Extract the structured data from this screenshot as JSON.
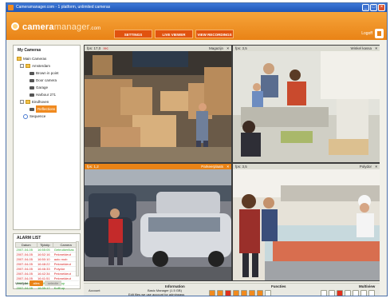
{
  "window": {
    "title": "Cameramanager.com - 1 platform, unlimited cameras"
  },
  "header": {
    "logo_main": "camera",
    "logo_second": "manager",
    "logo_suffix": ".com",
    "tabs": [
      {
        "label": "SETTINGS"
      },
      {
        "label": "LIVE VIEWER"
      },
      {
        "label": "VIEW RECORDINGS"
      }
    ],
    "logout_label": "Logoff"
  },
  "sidebar": {
    "title": "My Cameras",
    "tree": [
      {
        "label": "Main Cameras"
      },
      {
        "label": "Amsterdam"
      },
      {
        "label": "Brown in point"
      },
      {
        "label": "Door camera"
      },
      {
        "label": "Garage"
      },
      {
        "label": "Harbour 271"
      },
      {
        "label": "Eindhoven"
      },
      {
        "label": "Reflections"
      },
      {
        "label": "Sequence"
      }
    ]
  },
  "alarm": {
    "title": "ALARM LIST",
    "columns": [
      "Datum",
      "Tijdstip",
      "Camera"
    ],
    "rows": [
      {
        "date": "2007-04-05",
        "time": "16:55:05",
        "camera": "Gebruiker/kas"
      },
      {
        "date": "2007-04-05",
        "time": "16:52:16",
        "camera": "Pekmeldeut"
      },
      {
        "date": "2007-04-05",
        "time": "16:50:10",
        "camera": "auto mob"
      },
      {
        "date": "2007-04-05",
        "time": "16:48:22",
        "camera": "Pekmeldeut"
      },
      {
        "date": "2007-04-05",
        "time": "16:46:33",
        "camera": "Polydor"
      },
      {
        "date": "2007-04-05",
        "time": "16:42:34",
        "camera": "Pekmeldeut"
      },
      {
        "date": "2007-04-05",
        "time": "16:41:51",
        "camera": "Pekmeldeut"
      },
      {
        "date": "2007-04-05",
        "time": "16:39:16",
        "camera": "Koffi up"
      },
      {
        "date": "2007-04-05",
        "time": "16:35:17",
        "camera": "Koffi up"
      }
    ],
    "footer_label": "Verwijder",
    "btn_all": "alles",
    "btn_select": "selectie"
  },
  "panes": [
    {
      "fps": "fps: 17,0",
      "rec": "rec",
      "name": "Magazijn"
    },
    {
      "fps": "fps: 3,5",
      "name": "Winkel kassa"
    },
    {
      "fps": "fps: 1,2",
      "name": "Parkeerplaats"
    },
    {
      "fps": "fps: 3,5",
      "name": "Polydor"
    }
  ],
  "bottom": {
    "account_label": "Account",
    "information_label": "Information",
    "information_line1": "Basic Manager (1.5 GB)",
    "information_line2": "Edit files we use account for adminpass",
    "functions_label": "Functies",
    "multiview_label": "Multiview"
  },
  "colors": {
    "accent": "#e98316",
    "tab": "#e1530f"
  }
}
